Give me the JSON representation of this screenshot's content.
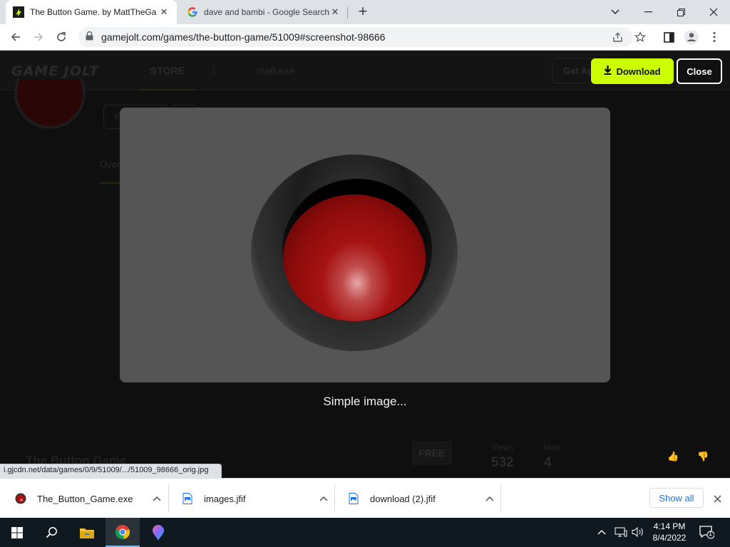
{
  "browser": {
    "tabs": [
      {
        "title": "The Button Game. by MattTheGa",
        "active": true
      },
      {
        "title": "dave and bambi - Google Search",
        "active": false
      }
    ],
    "url": "gamejolt.com/games/the-button-game/51009#screenshot-98666"
  },
  "gamejolt": {
    "logo": "GAME JOLT",
    "nav_store": "STORE",
    "search_value": "matt.exe",
    "get_app": "Get App",
    "follow": "Follow",
    "overview_tab": "Overview",
    "game_title": "The Button Game",
    "price_badge": "FREE",
    "stats": [
      {
        "label": "Views",
        "value": "532"
      },
      {
        "label": "likes",
        "value": "4"
      }
    ]
  },
  "lightbox": {
    "caption": "Simple image...",
    "download_label": "Download",
    "close_label": "Close"
  },
  "status_bar": {
    "link": "i.gjcdn.net/data/games/0/9/51009/.../51009_98666_orig.jpg"
  },
  "downloads": {
    "items": [
      {
        "name": "The_Button_Game.exe",
        "icon": "red-button-app-icon"
      },
      {
        "name": "images.jfif",
        "icon": "image-file-icon"
      },
      {
        "name": "download (2).jfif",
        "icon": "image-file-icon"
      }
    ],
    "show_all": "Show all"
  },
  "taskbar": {
    "time": "4:14 PM",
    "date": "8/4/2022",
    "notification_count": "1"
  },
  "colors": {
    "accent_download": "#ccff00",
    "chrome_tabstrip": "#dee1e6",
    "link_blue": "#1a73e8",
    "taskbar": "#101820"
  }
}
